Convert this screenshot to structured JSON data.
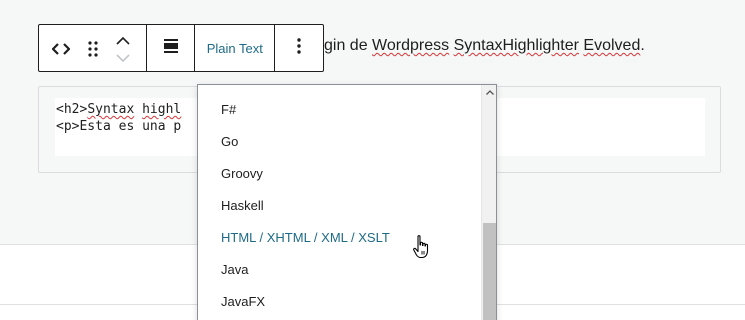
{
  "paragraph": {
    "visible_text": "gin de",
    "link1": "Wordpress",
    "link2": "SyntaxHighlighter",
    "link3": "Evolved",
    "end": "."
  },
  "code": {
    "line1_prefix": "<h2>",
    "line1_word1": "Syntax",
    "line1_word2": "highl",
    "line2": "<p>Esta es una p"
  },
  "toolbar": {
    "block_type_icon": "code-icon",
    "drag_icon": "drag-handle-icon",
    "move_up_icon": "chevron-up-icon",
    "move_down_icon": "chevron-down-icon",
    "align_icon": "align-icon",
    "language_label": "Plain Text",
    "more_icon": "more-vertical-icon"
  },
  "dropdown": {
    "items": [
      "F#",
      "Go",
      "Groovy",
      "Haskell",
      "HTML / XHTML / XML / XSLT",
      "Java",
      "JavaFX"
    ],
    "highlighted": "HTML / XHTML / XML / XSLT"
  },
  "colors": {
    "accent": "#1e6b87",
    "text": "#1e1e1e",
    "spellcheck": "#d63638"
  }
}
